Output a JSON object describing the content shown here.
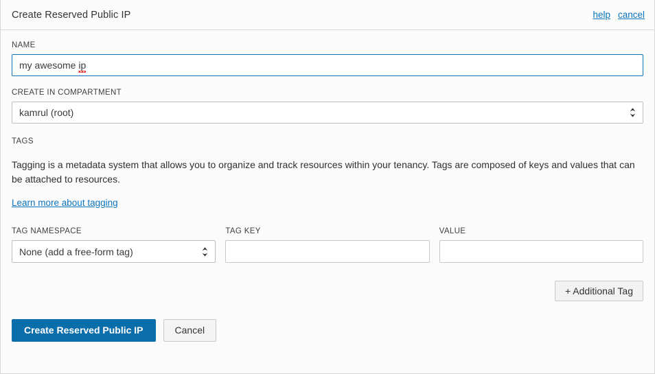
{
  "header": {
    "title": "Create Reserved Public IP",
    "help_label": "help",
    "cancel_label": "cancel"
  },
  "name_field": {
    "label": "NAME",
    "value_head": "my awesome ",
    "value_misspelled": "ip",
    "value_full": "my awesome ip",
    "placeholder": ""
  },
  "compartment_field": {
    "label": "CREATE IN COMPARTMENT",
    "selected": "kamrul (root)",
    "options": [
      "kamrul (root)"
    ]
  },
  "tags_section": {
    "label": "TAGS",
    "description": "Tagging is a metadata system that allows you to organize and track resources within your tenancy. Tags are composed of keys and values that can be attached to resources.",
    "learn_more_label": "Learn more about tagging"
  },
  "tag_row": {
    "namespace_label": "TAG NAMESPACE",
    "namespace_selected": "None (add a free-form tag)",
    "namespace_options": [
      "None (add a free-form tag)"
    ],
    "key_label": "TAG KEY",
    "key_value": "",
    "key_placeholder": "",
    "value_label": "VALUE",
    "value_value": "",
    "value_placeholder": ""
  },
  "buttons": {
    "additional_tag": "+ Additional Tag",
    "submit": "Create Reserved Public IP",
    "cancel": "Cancel"
  },
  "colors": {
    "primary": "#0a6eaa",
    "link": "#0a74bd",
    "focus_border": "#1171b8",
    "spellcheck": "#e02020"
  }
}
